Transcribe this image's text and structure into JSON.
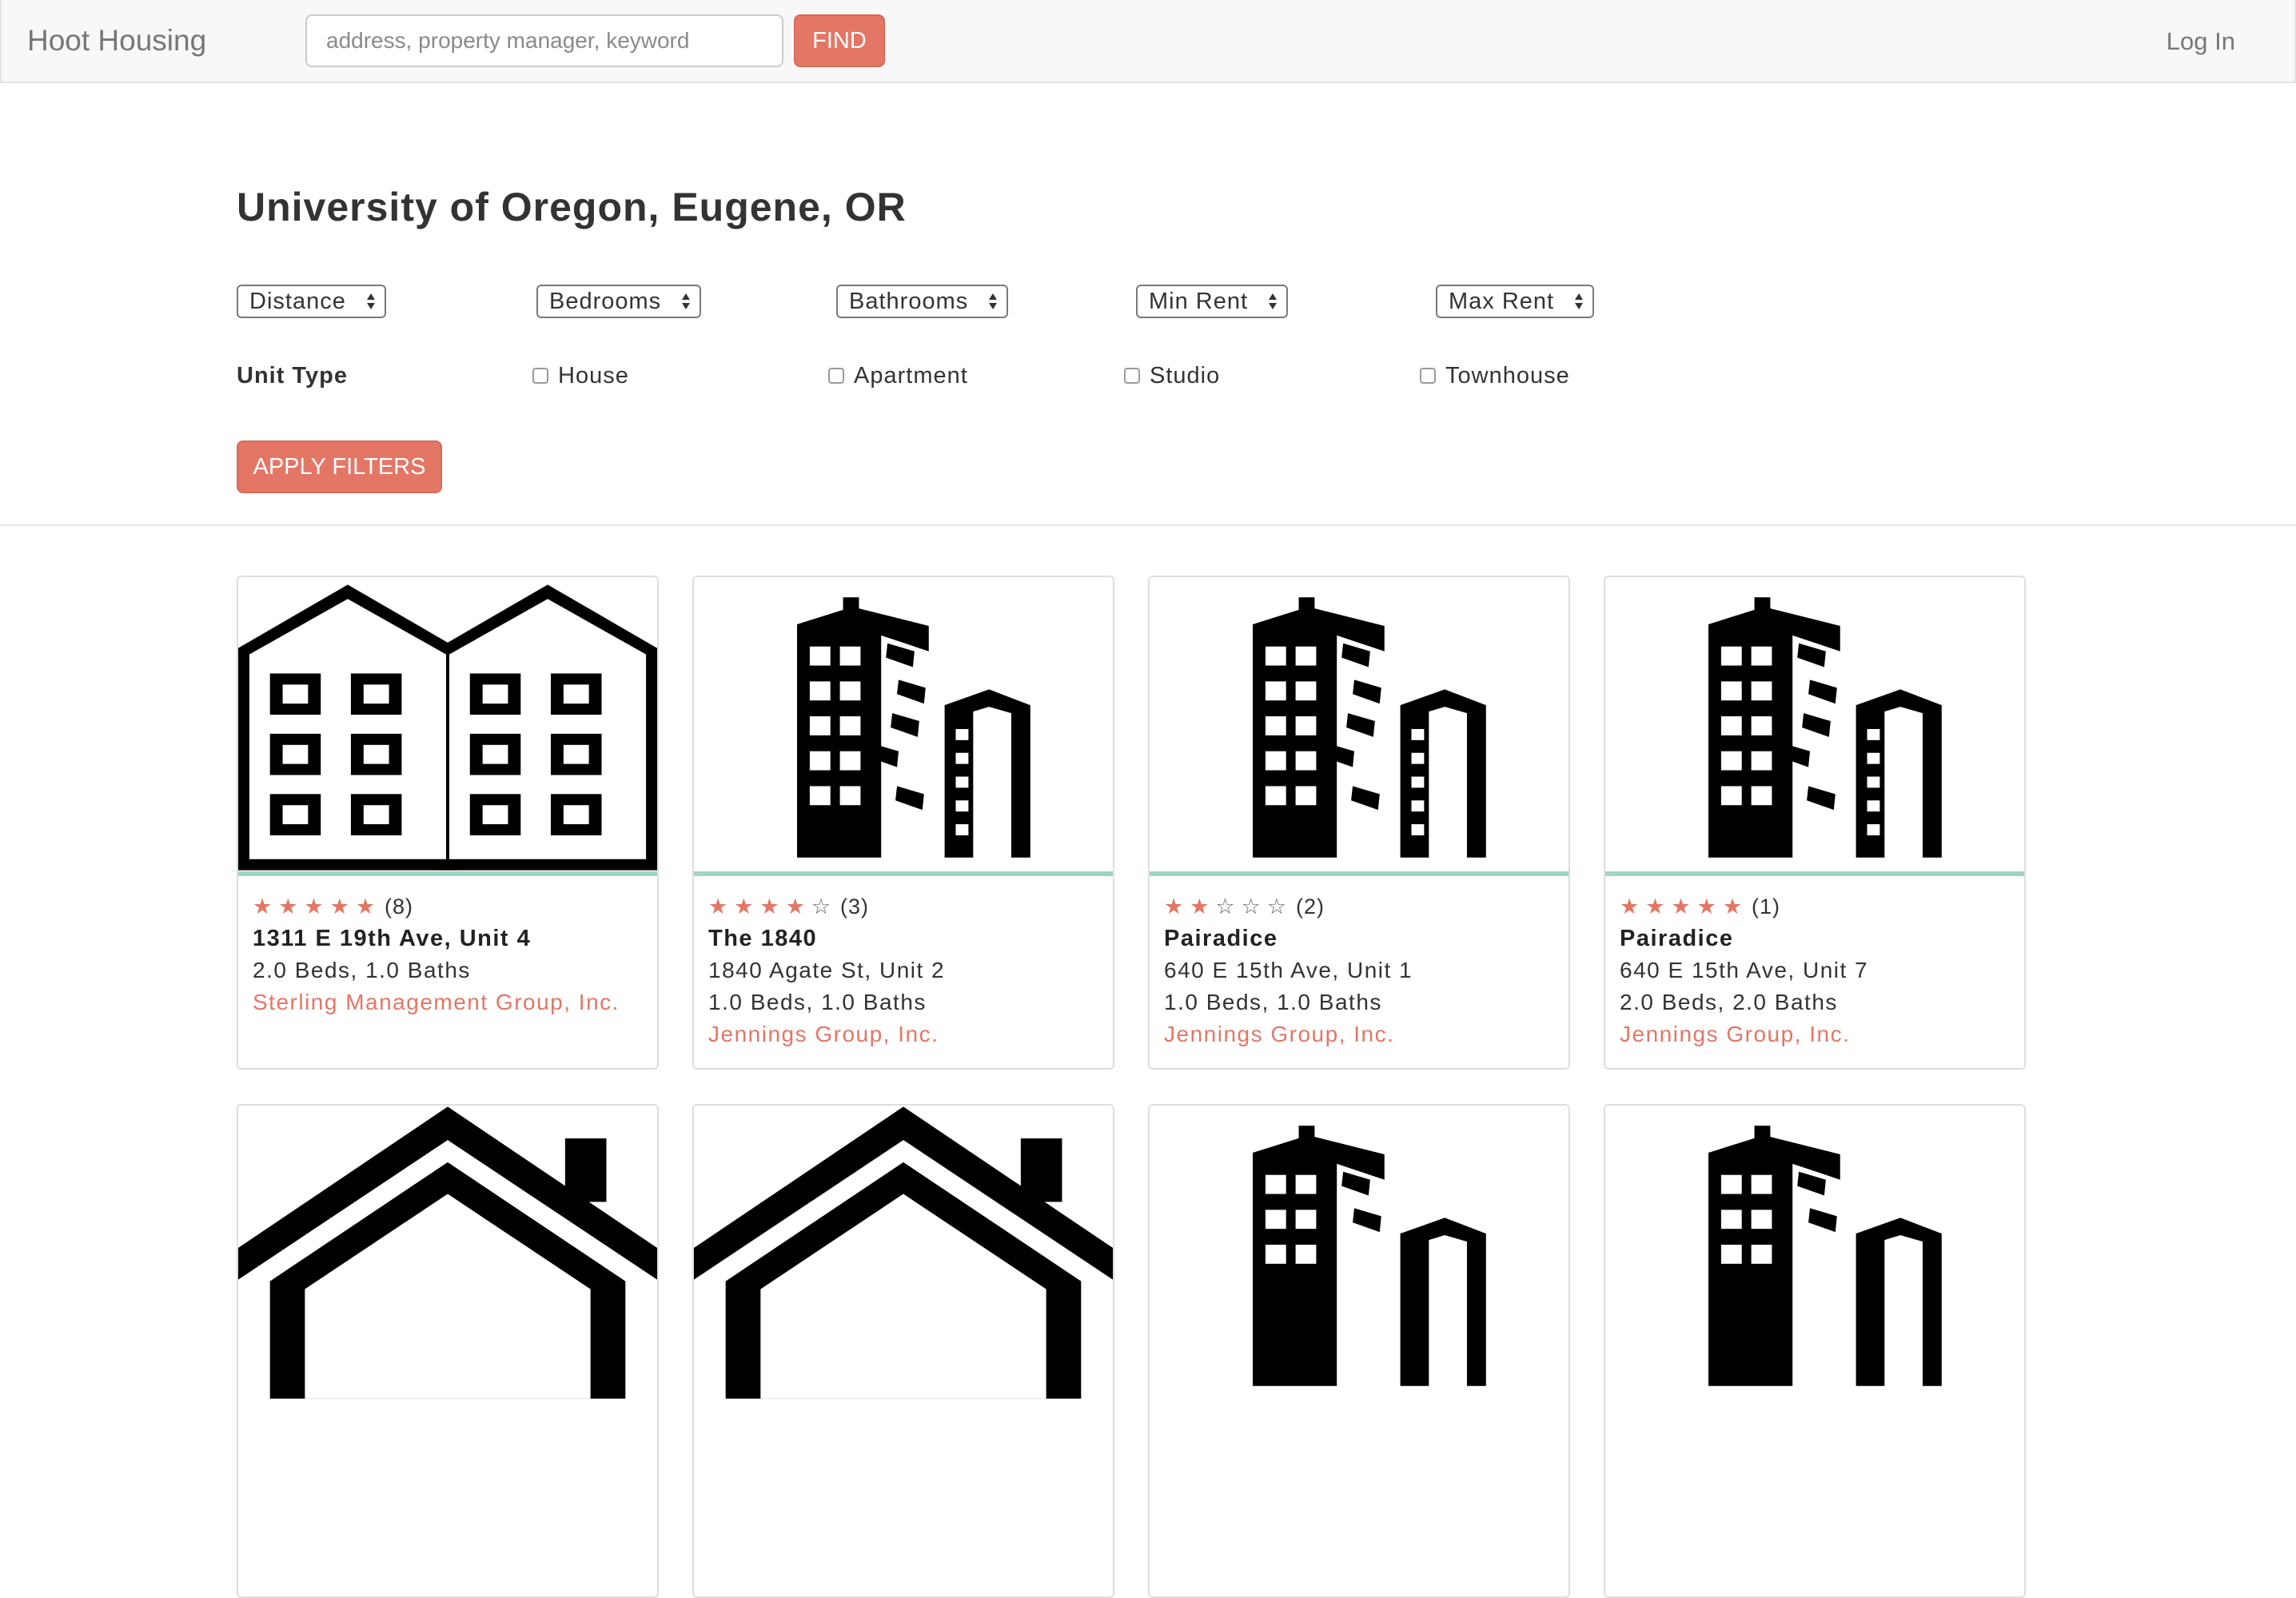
{
  "nav": {
    "brand": "Hoot Housing",
    "search_placeholder": "address, property manager, keyword",
    "search_value": "",
    "find_label": "FIND",
    "login_label": "Log In"
  },
  "page": {
    "title": "University of Oregon, Eugene, OR"
  },
  "filters": {
    "selects": [
      "Distance",
      "Bedrooms",
      "Bathrooms",
      "Min Rent",
      "Max Rent"
    ],
    "unit_type_label": "Unit Type",
    "unit_types": [
      "House",
      "Apartment",
      "Studio",
      "Townhouse"
    ],
    "apply_label": "APPLY FILTERS"
  },
  "colors": {
    "accent": "#e47665",
    "card_stripe": "#9fd5c4"
  },
  "listings": [
    {
      "image": "townhouse-icon",
      "stars": 5,
      "review_count": "(8)",
      "name": "1311 E 19th Ave, Unit 4",
      "address": "",
      "beds_baths": "2.0 Beds, 1.0 Baths",
      "manager": "Sterling Management Group, Inc."
    },
    {
      "image": "apartment-building-icon",
      "stars": 4,
      "review_count": "(3)",
      "name": "The 1840",
      "address": "1840 Agate St, Unit 2",
      "beds_baths": "1.0 Beds, 1.0 Baths",
      "manager": "Jennings Group, Inc."
    },
    {
      "image": "apartment-building-icon",
      "stars": 2,
      "review_count": "(2)",
      "name": "Pairadice",
      "address": "640 E 15th Ave, Unit 1",
      "beds_baths": "1.0 Beds, 1.0 Baths",
      "manager": "Jennings Group, Inc."
    },
    {
      "image": "apartment-building-icon",
      "stars": 5,
      "review_count": "(1)",
      "name": "Pairadice",
      "address": "640 E 15th Ave, Unit 7",
      "beds_baths": "2.0 Beds, 2.0 Baths",
      "manager": "Jennings Group, Inc."
    },
    {
      "image": "house-icon"
    },
    {
      "image": "house-icon"
    },
    {
      "image": "apartment-building-icon"
    },
    {
      "image": "apartment-building-icon"
    }
  ]
}
